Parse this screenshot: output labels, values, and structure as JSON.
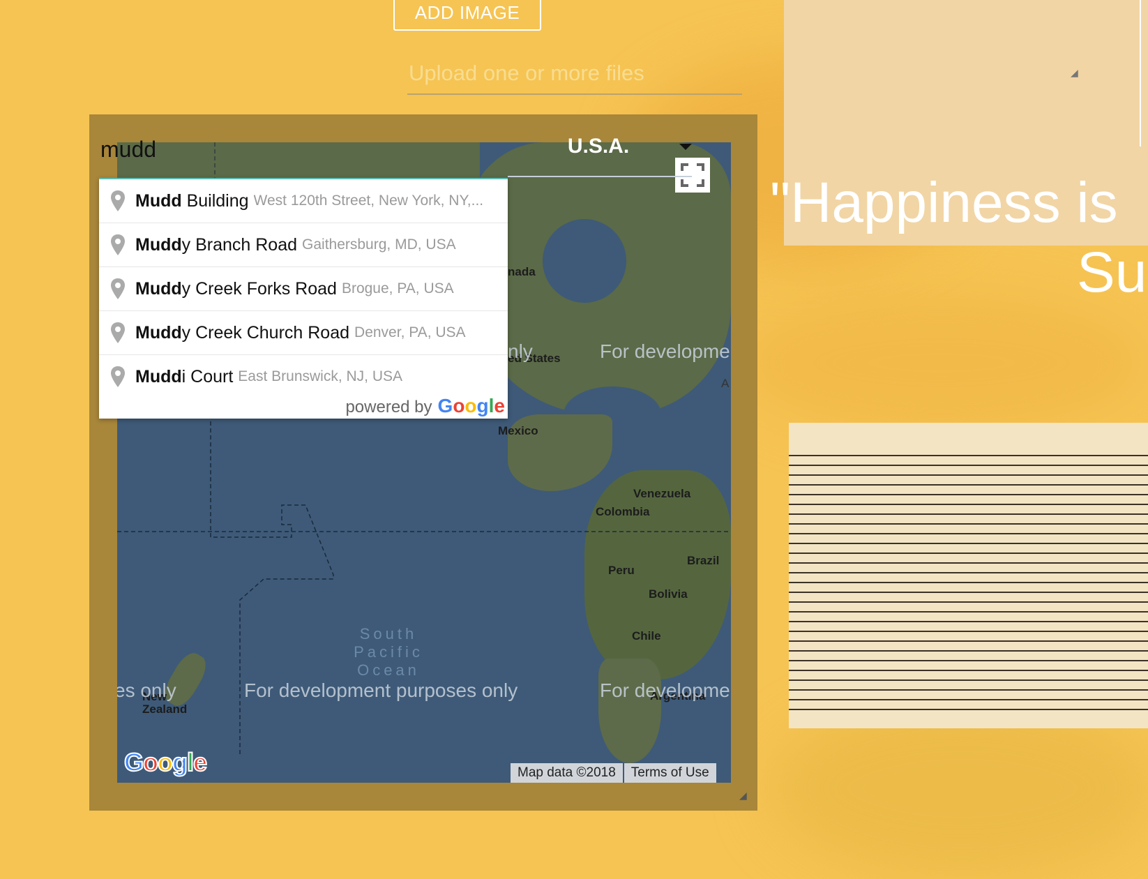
{
  "upload": {
    "button_label": "ADD IMAGE",
    "placeholder": "Upload one or more files"
  },
  "map": {
    "search_value": "mudd",
    "country": "U.S.A.",
    "labels": {
      "canada": "nada",
      "united_states": "ed States",
      "mexico": "Mexico",
      "venezuela": "Venezuela",
      "colombia": "Colombia",
      "peru": "Peru",
      "brazil": "Brazil",
      "bolivia": "Bolivia",
      "chile": "Chile",
      "argentina": "Argentina",
      "new_zealand": "New Zealand",
      "ocean": "South Pacific Ocean",
      "edge_a": "A"
    },
    "watermarks": {
      "bottom_left": "es only",
      "bottom_center": "For development purposes only",
      "bottom_right": "For developme",
      "mid_right": "For developme",
      "mid_left": "nly"
    },
    "logo": "Google",
    "map_data": "Map data ©2018",
    "terms": "Terms of Use"
  },
  "autocomplete": {
    "items": [
      {
        "match": "Mudd",
        "rest": " Building",
        "secondary": "West 120th Street, New York, NY,..."
      },
      {
        "match": "Mudd",
        "rest": "y Branch Road",
        "secondary": "Gaithersburg, MD, USA"
      },
      {
        "match": "Mudd",
        "rest": "y Creek Forks Road",
        "secondary": "Brogue, PA, USA"
      },
      {
        "match": "Mudd",
        "rest": "y Creek Church Road",
        "secondary": "Denver, PA, USA"
      },
      {
        "match": "Mudd",
        "rest": "i Court",
        "secondary": "East Brunswick, NJ, USA"
      }
    ],
    "powered_by": "powered by",
    "google": "Google"
  },
  "quote": {
    "line1": "\"Happiness is",
    "line2": "Su"
  },
  "colors": {
    "page_bg": "#f6c453",
    "frame": "#a8863a",
    "ocean": "#3e5a78",
    "accent_teal": "#5fbcb3"
  }
}
